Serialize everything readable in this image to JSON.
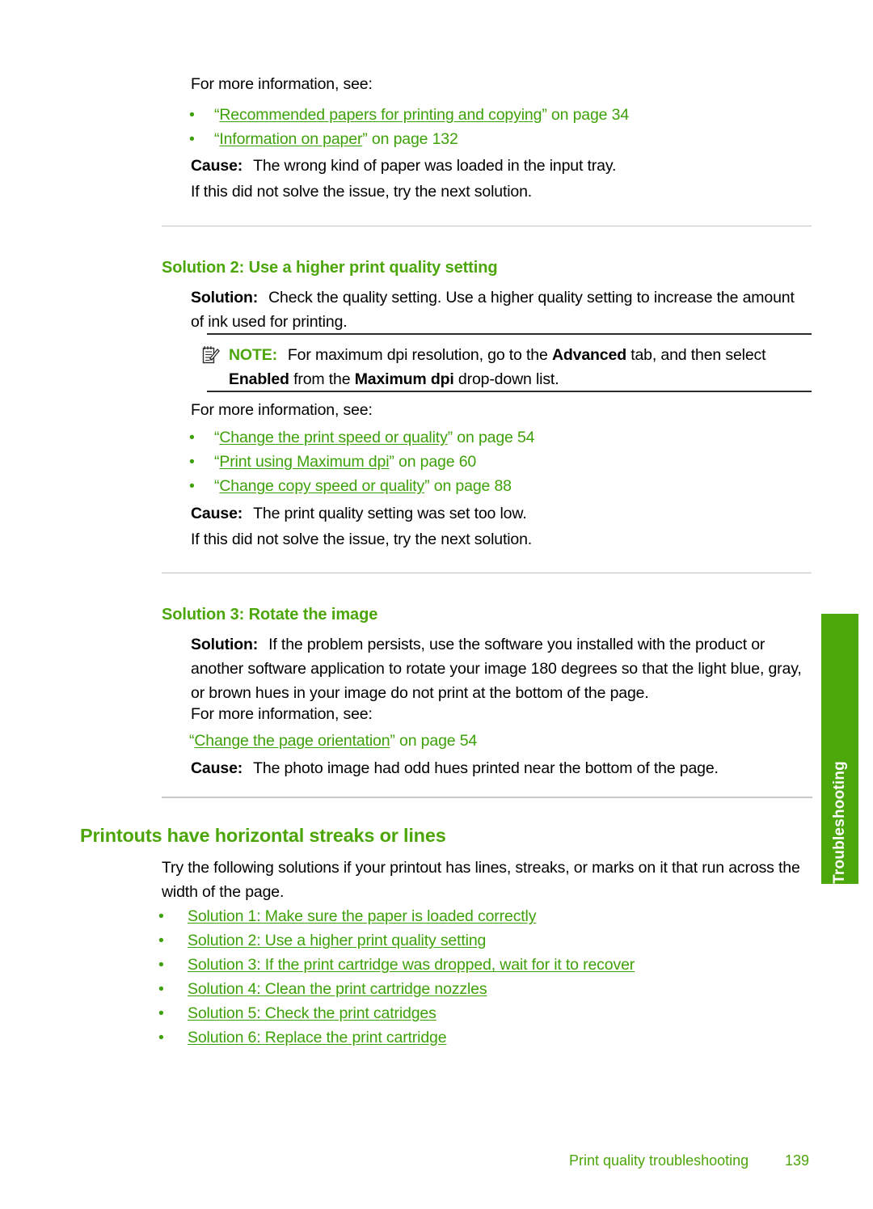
{
  "page": {
    "number": "139",
    "footer_title": "Print quality troubleshooting",
    "side_tab_label": "Troubleshooting",
    "accent_green": "#4CA60A",
    "link_green": "#3FA10A",
    "tab_green": "#4CA80A",
    "rule_light": "#C3C3C3",
    "rule_dark": "#2B2B2B"
  },
  "section_top": {
    "for_more_info": "For more information, see:",
    "links": [
      {
        "bullet": "•",
        "open_quote": "“",
        "text": "Recommended papers for printing and copying",
        "close_quote": "”",
        "suffix": " on page 34"
      },
      {
        "bullet": "•",
        "open_quote": "“",
        "text": "Information on paper",
        "close_quote": "”",
        "suffix": " on page 132"
      }
    ],
    "cause_label": "Cause:",
    "cause_text": "The wrong kind of paper was loaded in the input tray.",
    "next_solution": "If this did not solve the issue, try the next solution."
  },
  "solution2": {
    "heading": "Solution 2: Use a higher print quality setting",
    "solution_label": "Solution:",
    "solution_text": "Check the quality setting. Use a higher quality setting to increase the amount of ink used for printing.",
    "note": {
      "icon": "note-pencil-icon",
      "label": "NOTE:",
      "part1": "For maximum dpi resolution, go to the ",
      "bold1": "Advanced",
      "part2": " tab, and then select ",
      "bold2": "Enabled",
      "part3": " from the ",
      "bold3": "Maximum dpi",
      "part4": " drop-down list."
    },
    "for_more_info": "For more information, see:",
    "links": [
      {
        "bullet": "•",
        "open_quote": "“",
        "text": "Change the print speed or quality",
        "close_quote": "”",
        "suffix": " on page 54"
      },
      {
        "bullet": "•",
        "open_quote": "“",
        "text": "Print using Maximum dpi",
        "close_quote": "”",
        "suffix": " on page 60"
      },
      {
        "bullet": "•",
        "open_quote": "“",
        "text": "Change copy speed or quality",
        "close_quote": "”",
        "suffix": " on page 88"
      }
    ],
    "cause_label": "Cause:",
    "cause_text": "The print quality setting was set too low.",
    "next_solution": "If this did not solve the issue, try the next solution."
  },
  "solution3": {
    "heading": "Solution 3: Rotate the image",
    "solution_label": "Solution:",
    "solution_text": "If the problem persists, use the software you installed with the product or another software application to rotate your image 180 degrees so that the light blue, gray, or brown hues in your image do not print at the bottom of the page.",
    "for_more_info": "For more information, see:",
    "link": {
      "open_quote": "“",
      "text": "Change the page orientation",
      "close_quote": "”",
      "suffix": " on page 54"
    },
    "cause_label": "Cause:",
    "cause_text": "The photo image had odd hues printed near the bottom of the page."
  },
  "streaks_section": {
    "heading": "Printouts have horizontal streaks or lines",
    "intro": "Try the following solutions if your printout has lines, streaks, or marks on it that run across the width of the page.",
    "solution_links": [
      {
        "bullet": "•",
        "text": "Solution 1: Make sure the paper is loaded correctly"
      },
      {
        "bullet": "•",
        "text": "Solution 2: Use a higher print quality setting"
      },
      {
        "bullet": "•",
        "text": "Solution 3: If the print cartridge was dropped, wait for it to recover"
      },
      {
        "bullet": "•",
        "text": "Solution 4: Clean the print cartridge nozzles"
      },
      {
        "bullet": "•",
        "text": "Solution 5: Check the print catridges"
      },
      {
        "bullet": "•",
        "text": "Solution 6: Replace the print cartridge"
      }
    ]
  }
}
